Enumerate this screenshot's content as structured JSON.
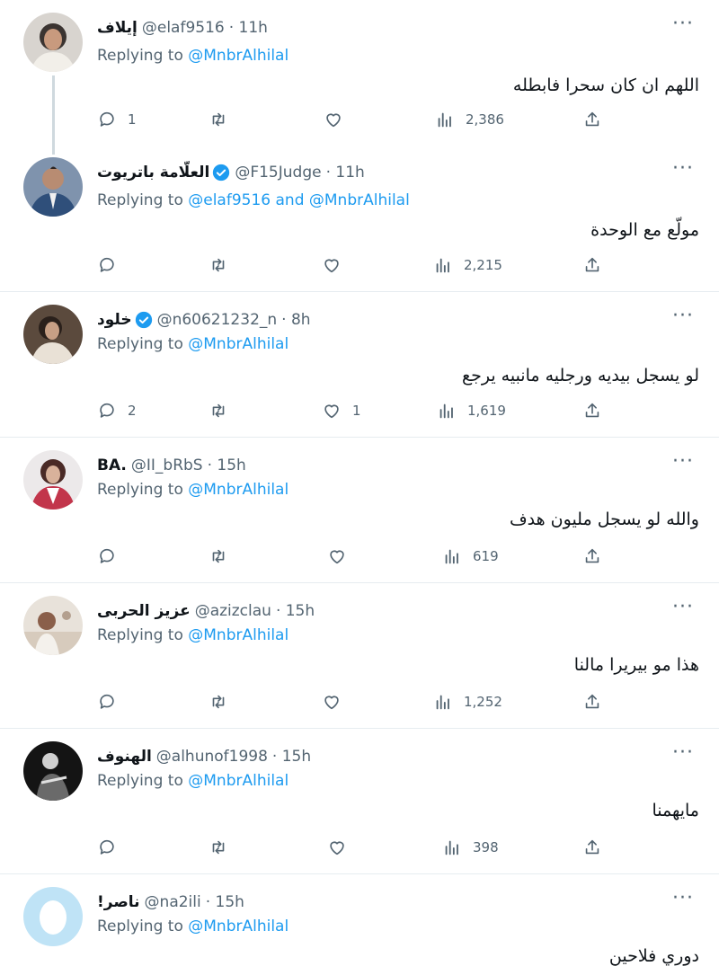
{
  "tweets": [
    {
      "name": "إيلاف",
      "verified": false,
      "handle": "@elaf9516",
      "time": "· 11h",
      "replying_prefix": "Replying to",
      "mentions": "@MnbrAlhilal",
      "text": "اللهم ان كان سحرا فابطله",
      "replies": "1",
      "retweets": "",
      "likes": "",
      "views": "2,386"
    },
    {
      "name": "العلّامة باتريوت",
      "verified": true,
      "handle": "@F15Judge",
      "time": "· 11h",
      "replying_prefix": "Replying to",
      "mentions": "@elaf9516 and @MnbrAlhilal",
      "text": "مولّع مع الوحدة",
      "replies": "",
      "retweets": "",
      "likes": "",
      "views": "2,215"
    },
    {
      "name": "خلود",
      "verified": true,
      "handle": "@n60621232_n",
      "time": "· 8h",
      "replying_prefix": "Replying to",
      "mentions": "@MnbrAlhilal",
      "text": "لو يسجل بيديه ورجليه مانبيه يرجع",
      "replies": "2",
      "retweets": "",
      "likes": "1",
      "views": "1,619"
    },
    {
      "name": "BA.",
      "verified": false,
      "handle": "@II_bRbS",
      "time": "· 15h",
      "replying_prefix": "Replying to",
      "mentions": "@MnbrAlhilal",
      "text": "والله لو يسجل مليون هدف",
      "replies": "",
      "retweets": "",
      "likes": "",
      "views": "619"
    },
    {
      "name": "عزيز الحربى",
      "verified": false,
      "handle": "@azizclau",
      "time": "· 15h",
      "replying_prefix": "Replying to",
      "mentions": "@MnbrAlhilal",
      "text": "هذا مو بيريرا مالنا",
      "replies": "",
      "retweets": "",
      "likes": "",
      "views": "1,252"
    },
    {
      "name": "الهنوف",
      "verified": false,
      "handle": "@alhunof1998",
      "time": "· 15h",
      "replying_prefix": "Replying to",
      "mentions": "@MnbrAlhilal",
      "text": "مايهمنا",
      "replies": "",
      "retweets": "",
      "likes": "",
      "views": "398"
    },
    {
      "name": "!ناصر",
      "verified": false,
      "handle": "@na2ili",
      "time": "· 15h",
      "replying_prefix": "Replying to",
      "mentions": "@MnbrAlhilal",
      "text": "دوري فلاحين",
      "replies": "",
      "retweets": "",
      "likes": "",
      "views": ""
    }
  ],
  "colors": {
    "accent": "#1d9bf0",
    "muted": "#536471",
    "divider": "#e6ecf0",
    "thread_line": "#cfd9de"
  },
  "icons": {
    "reply": "reply-icon",
    "retweet": "retweet-icon",
    "like": "heart-icon",
    "views": "views-chart-icon",
    "share": "share-icon",
    "more": "more-icon",
    "verified": "verified-badge-icon"
  }
}
